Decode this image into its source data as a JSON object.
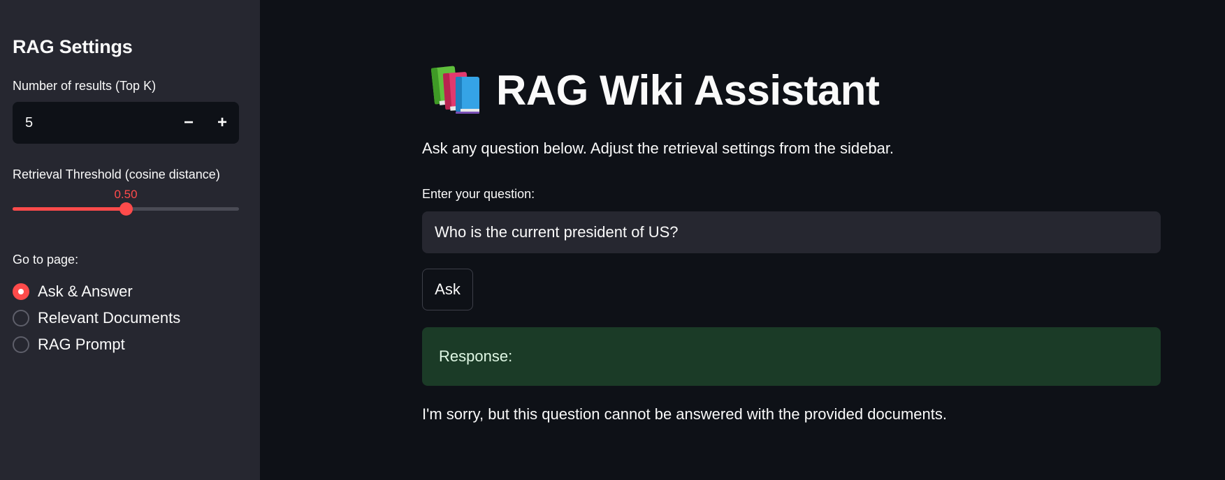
{
  "sidebar": {
    "title": "RAG Settings",
    "top_k": {
      "label": "Number of results (Top K)",
      "value": "5",
      "decrement": "−",
      "increment": "+"
    },
    "threshold": {
      "label": "Retrieval Threshold (cosine distance)",
      "value_text": "0.50",
      "value": 0.5,
      "min": 0.0,
      "max": 1.0,
      "accent": "#ff4b4b"
    },
    "nav": {
      "label": "Go to page:",
      "options": [
        {
          "label": "Ask & Answer",
          "selected": true
        },
        {
          "label": "Relevant Documents",
          "selected": false
        },
        {
          "label": "RAG Prompt",
          "selected": false
        }
      ]
    }
  },
  "main": {
    "title_icon": "books-icon",
    "title": "RAG Wiki Assistant",
    "subtitle": "Ask any question below. Adjust the retrieval settings from the sidebar.",
    "question": {
      "label": "Enter your question:",
      "value": "Who is the current president of US?"
    },
    "ask_label": "Ask",
    "response_label": "Response:",
    "answer": "I'm sorry, but this question cannot be answered with the provided documents."
  }
}
